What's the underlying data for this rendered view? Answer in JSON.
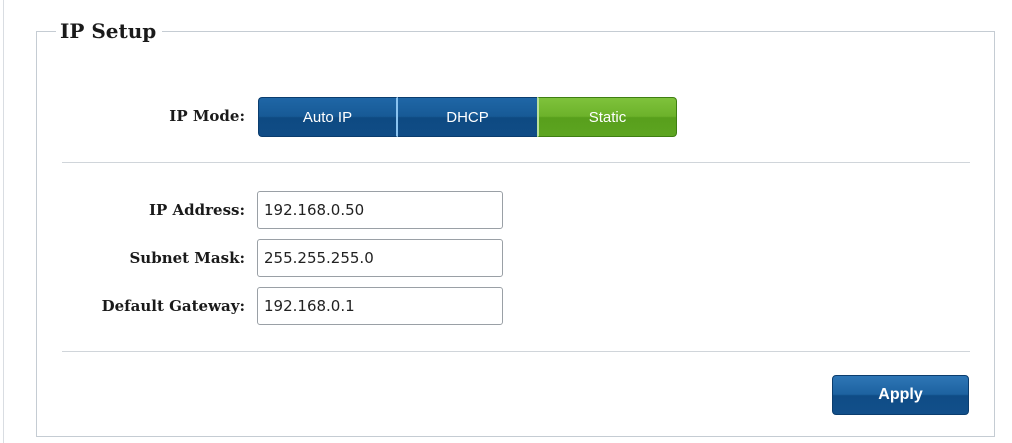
{
  "section": {
    "title": "IP Setup"
  },
  "ip_mode": {
    "label": "IP Mode:",
    "options": [
      {
        "label": "Auto IP",
        "selected": false
      },
      {
        "label": "DHCP",
        "selected": false
      },
      {
        "label": "Static",
        "selected": true
      }
    ],
    "selected": "Static"
  },
  "fields": {
    "ip_address": {
      "label": "IP Address:",
      "value": "192.168.0.50"
    },
    "subnet_mask": {
      "label": "Subnet Mask:",
      "value": "255.255.255.0"
    },
    "default_gateway": {
      "label": "Default Gateway:",
      "value": "192.168.0.1"
    }
  },
  "actions": {
    "apply_label": "Apply"
  },
  "colors": {
    "button_blue": "#175a96",
    "selected_green": "#6cb22a",
    "border": "#c5ccd3"
  }
}
